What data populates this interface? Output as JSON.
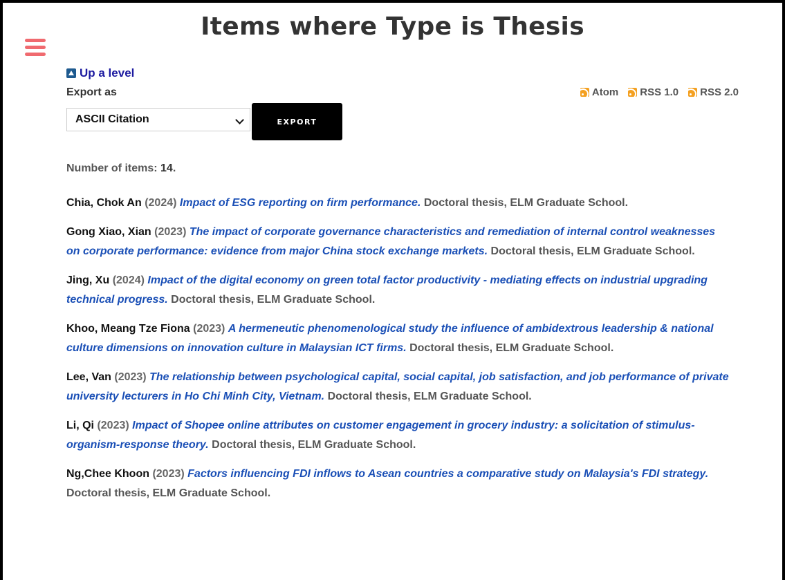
{
  "page": {
    "title": "Items where Type is Thesis"
  },
  "nav": {
    "up_level": "Up a level"
  },
  "export": {
    "label": "Export as",
    "selected_format": "ASCII Citation",
    "button_label": "EXPORT"
  },
  "feeds": [
    {
      "label": "Atom",
      "icon": "rss-icon"
    },
    {
      "label": "RSS 1.0",
      "icon": "rss-icon"
    },
    {
      "label": "RSS 2.0",
      "icon": "rss-icon"
    }
  ],
  "summary": {
    "label": "Number of items: ",
    "count": "14",
    "suffix": "."
  },
  "items": [
    {
      "author": "Chia, Chok An",
      "year": "(2024)",
      "title": "Impact of ESG reporting on firm performance.",
      "detail": "Doctoral thesis, ELM Graduate School."
    },
    {
      "author": "Gong Xiao, Xian",
      "year": "(2023)",
      "title": "The impact of corporate governance characteristics and remediation of internal control weaknesses on corporate performance: evidence from major China stock exchange markets.",
      "detail": "Doctoral thesis, ELM Graduate School."
    },
    {
      "author": "Jing, Xu",
      "year": "(2024)",
      "title": "Impact of the digital economy on green total factor productivity - mediating effects on industrial upgrading technical progress.",
      "detail": "Doctoral thesis, ELM Graduate School."
    },
    {
      "author": "Khoo, Meang Tze Fiona",
      "year": "(2023)",
      "title": "A hermeneutic phenomenological study the influence of ambidextrous leadership & national culture dimensions on innovation culture in Malaysian ICT firms.",
      "detail": "Doctoral thesis, ELM Graduate School."
    },
    {
      "author": "Lee, Van",
      "year": "(2023)",
      "title": "The relationship between psychological capital, social capital, job satisfaction, and job performance of private university lecturers in Ho Chi Minh City, Vietnam.",
      "detail": "Doctoral thesis, ELM Graduate School."
    },
    {
      "author": "Li, Qi",
      "year": "(2023)",
      "title": "Impact of Shopee online attributes on customer engagement in grocery industry: a solicitation of stimulus-organism-response theory.",
      "detail": "Doctoral thesis, ELM Graduate School."
    },
    {
      "author": "Ng,Chee Khoon",
      "year": "(2023)",
      "title": "Factors influencing FDI inflows to Asean countries a comparative study on Malaysia's FDI strategy.",
      "detail": "Doctoral thesis, ELM Graduate School."
    }
  ],
  "colors": {
    "menu_icon": "#f06a6f",
    "link": "#1a4fb6",
    "up_level": "#1c1aa0",
    "rss": "#f4a020",
    "export_button": "#000000"
  }
}
